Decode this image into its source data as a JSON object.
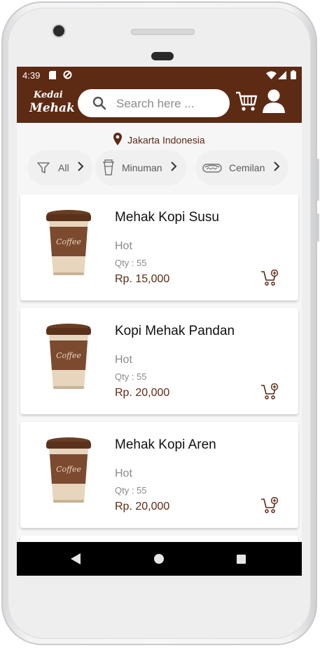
{
  "status_bar": {
    "time": "4:39"
  },
  "app_bar": {
    "logo_line1": "Kedai",
    "logo_line2": "Mehak",
    "search_placeholder": "Search here ..."
  },
  "location": "Jakarta Indonesia",
  "categories": [
    {
      "label": "All",
      "icon": "filter-icon"
    },
    {
      "label": "Minuman",
      "icon": "cup-icon"
    },
    {
      "label": "Cemilan",
      "icon": "hotdog-icon"
    }
  ],
  "products": [
    {
      "name": "Mehak Kopi Susu",
      "type": "Hot",
      "qty": "Qty : 55",
      "price": "Rp. 15,000"
    },
    {
      "name": "Kopi Mehak Pandan",
      "type": "Hot",
      "qty": "Qty : 55",
      "price": "Rp. 20,000"
    },
    {
      "name": "Mehak Kopi Aren",
      "type": "Hot",
      "qty": "Qty : 55",
      "price": "Rp. 20,000"
    }
  ],
  "colors": {
    "brand": "#5d2a14",
    "background": "#f6f6f6"
  }
}
